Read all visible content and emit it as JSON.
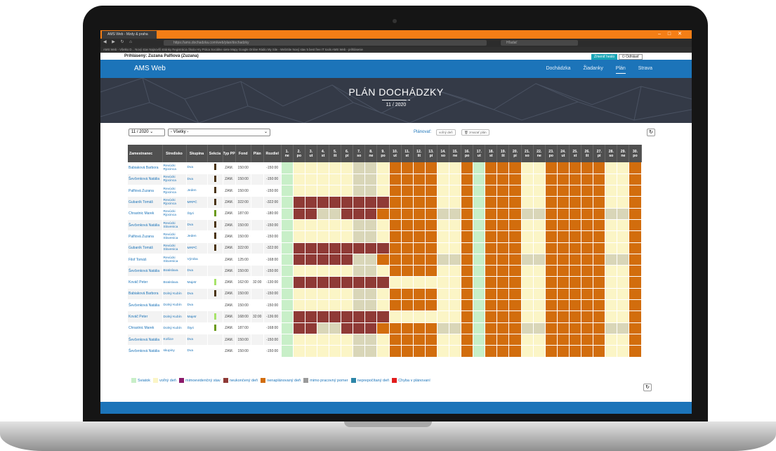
{
  "browser": {
    "tab_title": "AMS Web - Mzdy & praha",
    "url": "https://ams.dochadzka.com/web/plan/dochadzky",
    "search_placeholder": "Hľadať",
    "bookmarks": "AMS Web - Všetko D...   Nový stav   Najnovší stránky   Registrácia   Škola   Hry   Práca   Sociálne siete   Mapy Google   Online   Rádio   My Site - WebSite   Nový stav   5 best free IT tools   AMS Web - prihlásenie"
  },
  "user_bar": {
    "logged_in": "Prihlásený: Zuzana Palfiová (Zuzana)",
    "swap_label": "Zmeniť heslo",
    "logout_label": "Odhlásiť"
  },
  "app": {
    "brand": "AMS Web",
    "menu": [
      "Dochádzka",
      "Žiadanky",
      "Plán",
      "Strava"
    ]
  },
  "hero": {
    "title": "PLÁN DOCHÁDZKY",
    "subtitle": "11 / 2020"
  },
  "controls": {
    "month": "11 / 2020",
    "group": "- Všetky -",
    "plan_label": "Plánovať:",
    "free_day": "voľný deň",
    "delete_plan": "zmazať plán"
  },
  "table": {
    "headers": [
      "Zamestnanec",
      "Stredisko",
      "Skupina",
      "Sekcia",
      "Typ PP",
      "Fond",
      "Plán",
      "Rozdiel"
    ],
    "days": [
      "1. ne",
      "2. po",
      "3. ut",
      "4. st",
      "5. št",
      "6. pi",
      "7. so",
      "8. ne",
      "9. po",
      "10. ut",
      "11. st",
      "12. št",
      "13. pi",
      "14. so",
      "15. ne",
      "16. po",
      "17. ut",
      "18. st",
      "19. št",
      "20. pi",
      "21. so",
      "22. ne",
      "23. po",
      "24. ut",
      "25. st",
      "26. št",
      "27. pi",
      "28. so",
      "29. ne",
      "30. po"
    ],
    "rows": [
      {
        "name": "Babiaková Barbora",
        "center": "Revúcki Rjocinca",
        "group": "Dva",
        "type": "ZAM.",
        "fund": "150:00",
        "plan": "",
        "diff": "-150:00",
        "pattern": "A",
        "sek": "#4a3412"
      },
      {
        "name": "Ševčenková Natália",
        "center": "Revúcki Rjocinca",
        "group": "Dva",
        "type": "ZAM.",
        "fund": "150:00",
        "plan": "",
        "diff": "-150:00",
        "pattern": "A",
        "sek": "#4a3412"
      },
      {
        "name": "Palfiová Zuzana",
        "center": "Revúcki Rjocinca",
        "group": "Jeden",
        "type": "ZAM.",
        "fund": "150:00",
        "plan": "",
        "diff": "-150:00",
        "pattern": "A",
        "sek": "#4a3412"
      },
      {
        "name": "Gubaník Tomáš",
        "center": "Revúcki Rjocinca",
        "group": "MRPČ",
        "type": "ZAM.",
        "fund": "322:00",
        "plan": "",
        "diff": "-322:00",
        "pattern": "B",
        "sek": "#4a3412"
      },
      {
        "name": "Chrastnic Marek",
        "center": "Revúcki Rjocinca",
        "group": "Štyri",
        "type": "ZAM.",
        "fund": "187:00",
        "plan": "",
        "diff": "-180:00",
        "pattern": "C",
        "sek": "#6b9a1a"
      },
      {
        "name": "Ševčenková Natália",
        "center": "Revúcki Slovenica",
        "group": "Dva",
        "type": "ZAM.",
        "fund": "150:00",
        "plan": "",
        "diff": "-150:00",
        "pattern": "A",
        "sek": "#4a3412"
      },
      {
        "name": "Palfiová Zuzana",
        "center": "Revúcki Slovenica",
        "group": "Jeden",
        "type": "ZAM.",
        "fund": "150:00",
        "plan": "",
        "diff": "-150:00",
        "pattern": "A",
        "sek": "#4a3412"
      },
      {
        "name": "Gubaník Tomáš",
        "center": "Revúcki Slovenica",
        "group": "MRPČ",
        "type": "ZAM.",
        "fund": "322:00",
        "plan": "",
        "diff": "-322:00",
        "pattern": "B",
        "sek": "#4a3412"
      },
      {
        "name": "Filof Tomáš",
        "center": "Revúcki Slovenica",
        "group": "Výroba",
        "type": "ZAM.",
        "fund": "125:00",
        "plan": "",
        "diff": "-168:00",
        "pattern": "D",
        "sek": ""
      },
      {
        "name": "Ševčenková Natália",
        "center": "Bratislava",
        "group": "Dva",
        "type": "ZAM.",
        "fund": "150:00",
        "plan": "",
        "diff": "-150:00",
        "pattern": "A",
        "sek": ""
      },
      {
        "name": "Kováč Peter",
        "center": "Bratislava",
        "group": "Majetr",
        "type": "ZAM.",
        "fund": "162:00",
        "plan": "32:00",
        "diff": "-130:00",
        "pattern": "E",
        "sek": "#a7e36a"
      },
      {
        "name": "Babiaková Barbora",
        "center": "Dolný Kubín",
        "group": "Dva",
        "type": "ZAM.",
        "fund": "150:00",
        "plan": "",
        "diff": "-150:00",
        "pattern": "A",
        "sek": "#4a3412"
      },
      {
        "name": "Ševčenková Natália",
        "center": "Dolný Kubín",
        "group": "Dva",
        "type": "ZAM.",
        "fund": "150:00",
        "plan": "",
        "diff": "-150:00",
        "pattern": "A",
        "sek": ""
      },
      {
        "name": "Kováč Peter",
        "center": "Dolný Kubín",
        "group": "Majetr",
        "type": "ZAM.",
        "fund": "168:00",
        "plan": "32:00",
        "diff": "-136:00",
        "pattern": "E",
        "sek": "#a7e36a"
      },
      {
        "name": "Chrastnic Marek",
        "center": "Dolný Kubín",
        "group": "Štyri",
        "type": "ZAM.",
        "fund": "187:00",
        "plan": "",
        "diff": "-168:00",
        "pattern": "C",
        "sek": "#6b9a1a"
      },
      {
        "name": "Ševčenková Natália",
        "center": "Košice",
        "group": "Dva",
        "type": "ZAM.",
        "fund": "150:00",
        "plan": "",
        "diff": "-150:00",
        "pattern": "A",
        "sek": ""
      },
      {
        "name": "Ševčenková Natália",
        "center": "skupiny",
        "group": "Dva",
        "type": "ZAM.",
        "fund": "150:00",
        "plan": "",
        "diff": "-150:00",
        "pattern": "A",
        "sek": ""
      }
    ]
  },
  "legend": [
    {
      "label": "Sviatok",
      "color": "#c8efc8"
    },
    {
      "label": "voľný deň",
      "color": "#fbf5c6"
    },
    {
      "label": "mimoevidenčný stav",
      "color": "#8b1a6a"
    },
    {
      "label": "neukončený deň",
      "color": "#8f3a36"
    },
    {
      "label": "nenaplánovaný deň",
      "color": "#d26d0d"
    },
    {
      "label": "mimo pracovný pomer",
      "color": "#9a9a9a"
    },
    {
      "label": "neprepočítaný deň",
      "color": "#2d86a8"
    },
    {
      "label": "Chyba v plánovaní",
      "color": "#e21d1d"
    }
  ],
  "colors": {
    "weekend": "#fbf5c6",
    "unplanned": "#d26d0d",
    "unfinished": "#8f3a36",
    "holiday": "#c8efc8",
    "empty": "#d9d6b8"
  }
}
